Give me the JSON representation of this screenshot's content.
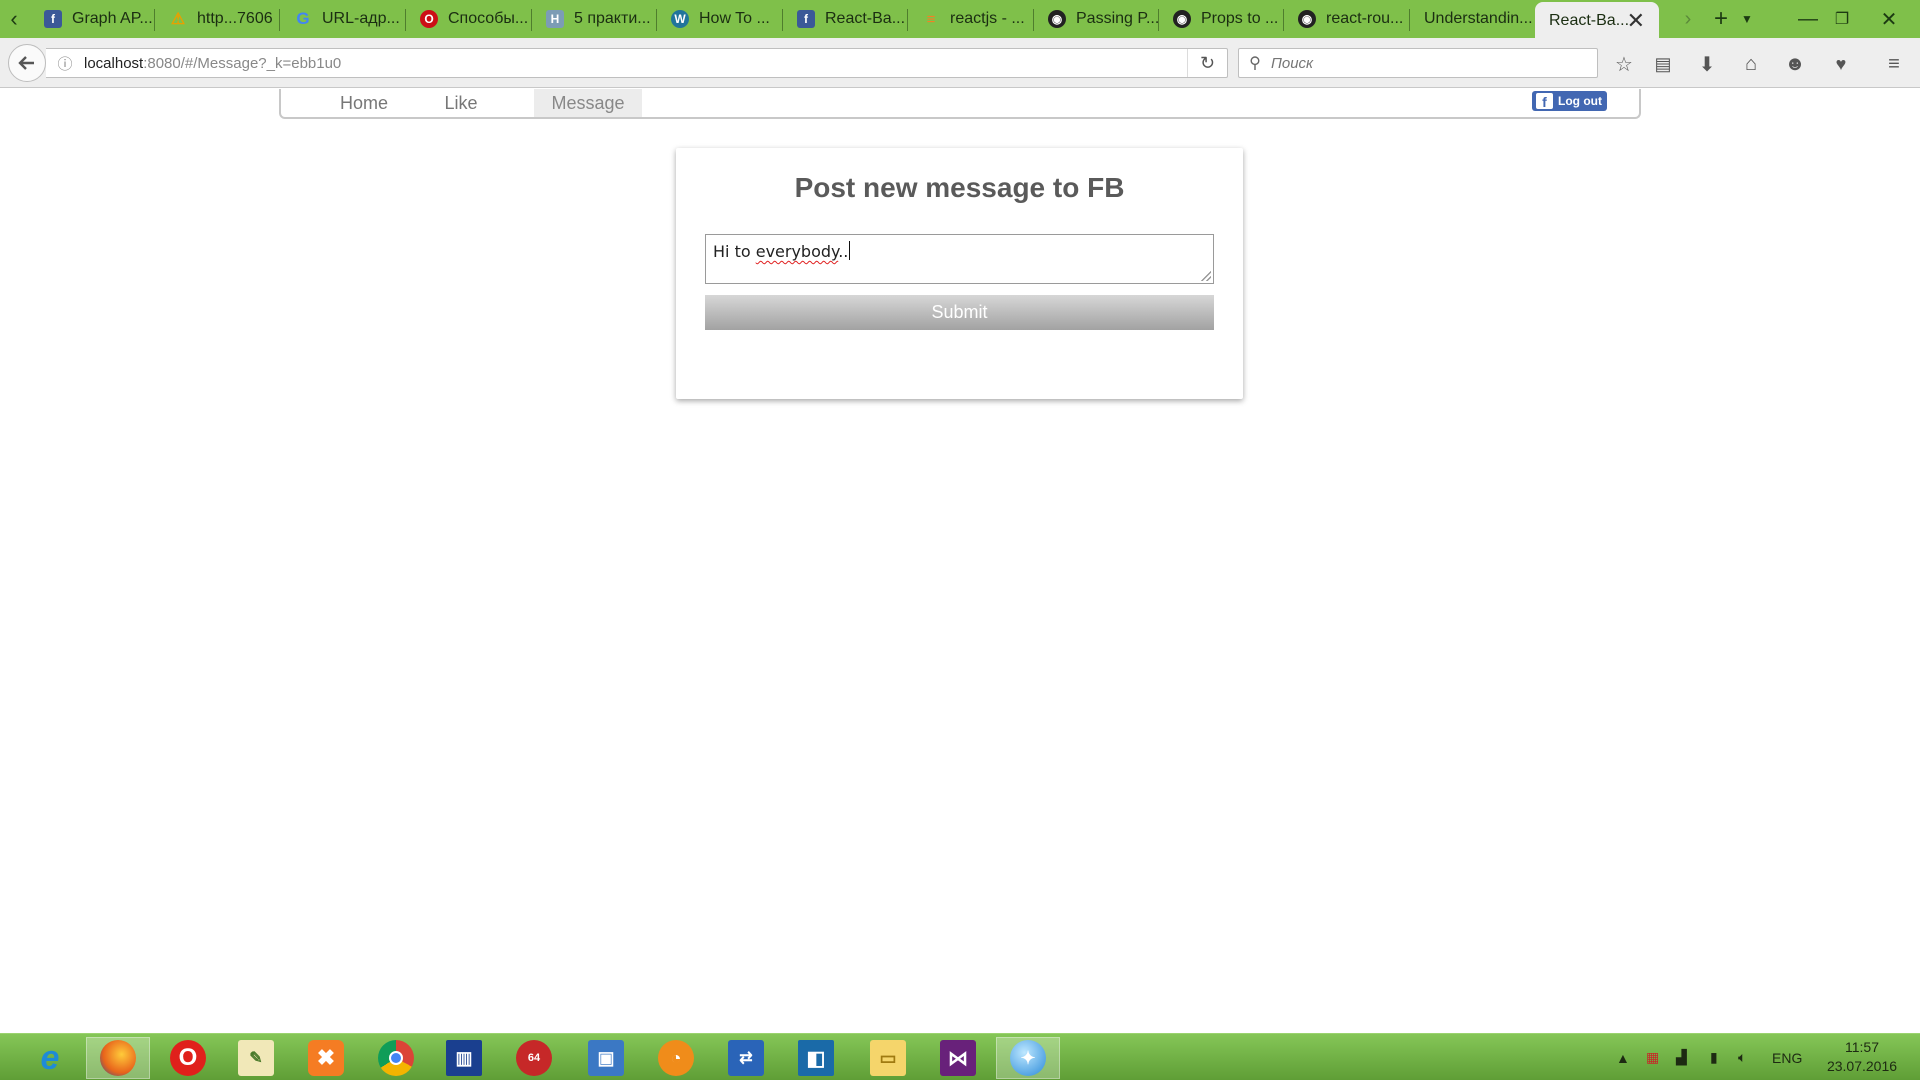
{
  "tabs": [
    {
      "label": "Graph AP...",
      "icon": "facebook-icon",
      "color": "#3b5998"
    },
    {
      "label": "http...7606",
      "icon": "warning-icon",
      "color": "#e8a000"
    },
    {
      "label": "URL-адр...",
      "icon": "google-icon",
      "color": "#4285f4"
    },
    {
      "label": "Способы...",
      "icon": "opera-icon",
      "color": "#cc0f16"
    },
    {
      "label": "5 практи...",
      "icon": "habr-icon",
      "color": "#7c9cb5"
    },
    {
      "label": "How To ...",
      "icon": "wordpress-icon",
      "color": "#21759b"
    },
    {
      "label": "React-Ba...",
      "icon": "facebook-icon",
      "color": "#3b5998"
    },
    {
      "label": "reactjs - ...",
      "icon": "stackoverflow-icon",
      "color": "#f48024"
    },
    {
      "label": "Passing P...",
      "icon": "github-icon",
      "color": "#222222"
    },
    {
      "label": "Props to ...",
      "icon": "github-icon",
      "color": "#222222"
    },
    {
      "label": "react-rou...",
      "icon": "github-icon",
      "color": "#222222"
    },
    {
      "label": "Understandin...",
      "icon": "",
      "color": ""
    },
    {
      "label": "React-Ba...",
      "icon": "",
      "color": "",
      "active": true
    }
  ],
  "browser": {
    "url_host": "localhost",
    "url_rest": ":8080/#/Message?_k=ebb1u0",
    "search_placeholder": "Поиск"
  },
  "app": {
    "nav": {
      "home": "Home",
      "like": "Like",
      "message": "Message"
    },
    "logout": "Log out",
    "title": "Post new message to FB",
    "message_word1": "Hi to ",
    "message_word2": "everybody",
    "message_word3": "..",
    "submit": "Submit"
  },
  "taskbar": {
    "lang": "ENG",
    "time": "11:57",
    "date": "23.07.2016"
  },
  "colors": {
    "tabbar": "#7fc04a",
    "fb_blue": "#4267b2",
    "title_gray": "#5a5a5a"
  }
}
